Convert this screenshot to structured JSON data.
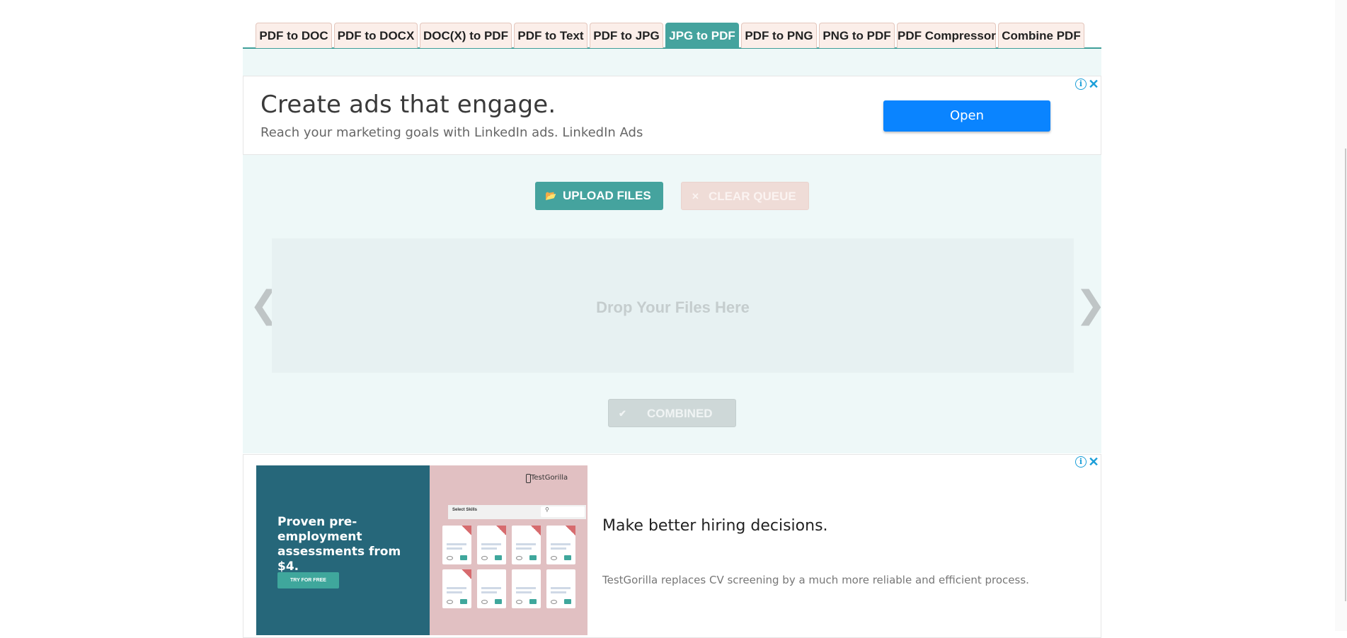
{
  "tabs": [
    {
      "label": "PDF to DOC",
      "active": false
    },
    {
      "label": "PDF to DOCX",
      "active": false
    },
    {
      "label": "DOC(X) to PDF",
      "active": false
    },
    {
      "label": "PDF to Text",
      "active": false
    },
    {
      "label": "PDF to JPG",
      "active": false
    },
    {
      "label": "JPG to PDF",
      "active": true
    },
    {
      "label": "PDF to PNG",
      "active": false
    },
    {
      "label": "PNG to PDF",
      "active": false
    },
    {
      "label": "PDF Compressor",
      "active": false
    },
    {
      "label": "Combine PDF",
      "active": false
    }
  ],
  "ad_top": {
    "headline": "Create ads that engage.",
    "text": "Reach your marketing goals with LinkedIn ads. LinkedIn Ads",
    "button": "Open",
    "choices_icon": "i",
    "close_icon": "✕"
  },
  "actions": {
    "upload": "UPLOAD FILES",
    "upload_icon": "📂",
    "clear": "CLEAR QUEUE",
    "clear_icon": "✕",
    "combined": "COMBINED",
    "combined_icon": "✔"
  },
  "dropzone": {
    "text": "Drop Your Files Here",
    "prev": "❮",
    "next": "❯"
  },
  "ad_bottom": {
    "left_text": "Proven pre-employment assessments from $4.",
    "try_button": "TRY FOR FREE",
    "brand": "TestGorilla",
    "select_skills": "Select Skills",
    "headline": "Make better hiring decisions.",
    "body": "TestGorilla replaces CV screening by a much more reliable and efficient process.",
    "choices_icon": "i",
    "close_icon": "✕"
  },
  "colors": {
    "accent": "#45a39e",
    "panel_bg": "#eef8f8",
    "tab_bg": "#fbeee9",
    "open_button": "#0a84ff"
  }
}
